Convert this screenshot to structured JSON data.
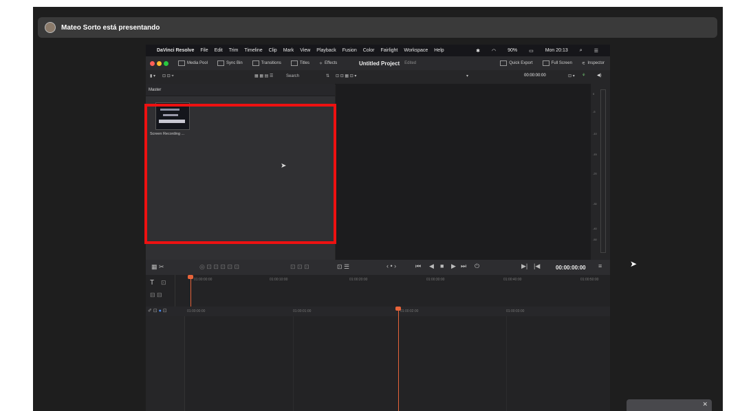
{
  "presenter": {
    "text": "Mateo Sorto está presentando"
  },
  "menubar": {
    "items": [
      "DaVinci Resolve",
      "File",
      "Edit",
      "Trim",
      "Timeline",
      "Clip",
      "Mark",
      "View",
      "Playback",
      "Fusion",
      "Color",
      "Fairlight",
      "Workspace",
      "Help"
    ],
    "battery": "90%",
    "clock": "Mon 20:13"
  },
  "toolbar": {
    "media_pool": "Media Pool",
    "sync_bin": "Sync Bin",
    "transitions": "Transitions",
    "titles": "Titles",
    "effects": "Effects",
    "project_title": "Untitled Project",
    "project_status": "Edited",
    "quick_export": "Quick Export",
    "full_screen": "Full Screen",
    "inspector": "Inspector"
  },
  "subtool": {
    "search": "Search",
    "source_timecode": "00:00:00:00"
  },
  "media": {
    "bin": "Master",
    "clip_name": "Screen Recording ..."
  },
  "transport": {
    "timecode": "00:00:00:00"
  },
  "ruler": {
    "top": [
      "01:00:00:00",
      "01:00:10:00",
      "01:00:20:00",
      "01:00:30:00",
      "01:00:40:00",
      "01:00:50:00"
    ],
    "main": [
      "01:00:00:00",
      "01:00:01:00",
      "01:00:02:00",
      "01:00:03:00"
    ]
  },
  "meter": {
    "labels": [
      "0",
      "-5",
      "-10",
      "-15",
      "-20",
      "-30",
      "-40",
      "-50"
    ]
  },
  "colors": {
    "highlight": "#ee1111",
    "playhead": "#e8643a"
  }
}
